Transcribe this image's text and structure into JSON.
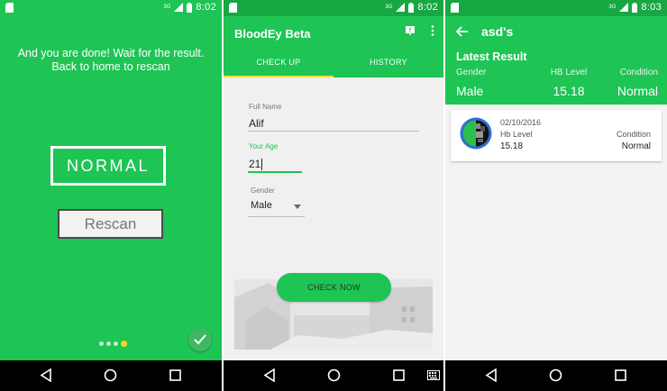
{
  "status_bar": {
    "time_1": "8:02",
    "time_2": "8:02",
    "time_3": "8:03",
    "network": "3G"
  },
  "screen1": {
    "message": "And you are done! Wait for the result. Back to home to rescan",
    "result": "NORMAL",
    "rescan_label": "Rescan",
    "pager": {
      "count": 4,
      "active": 4
    }
  },
  "screen2": {
    "app_title": "BloodEy Beta",
    "tabs": [
      "CHECK UP",
      "HISTORY"
    ],
    "active_tab": "CHECK UP",
    "form": {
      "full_name_label": "Full Name",
      "full_name_value": "Alif",
      "age_label": "Your Age",
      "age_value": "21",
      "gender_label": "Gender",
      "gender_value": "Male"
    },
    "check_now_label": "CHECK NOW"
  },
  "screen3": {
    "title": "asd's",
    "latest_title": "Latest Result",
    "headers": {
      "gender": "Gender",
      "hb": "HB Level",
      "condition": "Condition"
    },
    "values": {
      "gender": "Male",
      "hb": "15.18",
      "condition": "Normal"
    },
    "history": [
      {
        "date": "02/10/2016",
        "hb_label": "Hb Level",
        "hb_value": "15.18",
        "condition_label": "Condition",
        "condition_value": "Normal"
      }
    ]
  },
  "colors": {
    "primary": "#1ec454",
    "primary_dark": "#17a743",
    "accent": "#ffe23f"
  },
  "icons": [
    "sim-icon",
    "network-icon",
    "signal-icon",
    "battery-icon",
    "back-nav-icon",
    "home-nav-icon",
    "recents-nav-icon",
    "keyboard-icon",
    "check-icon",
    "info-icon",
    "overflow-menu-icon",
    "back-arrow-icon",
    "dropdown-arrow-icon"
  ]
}
